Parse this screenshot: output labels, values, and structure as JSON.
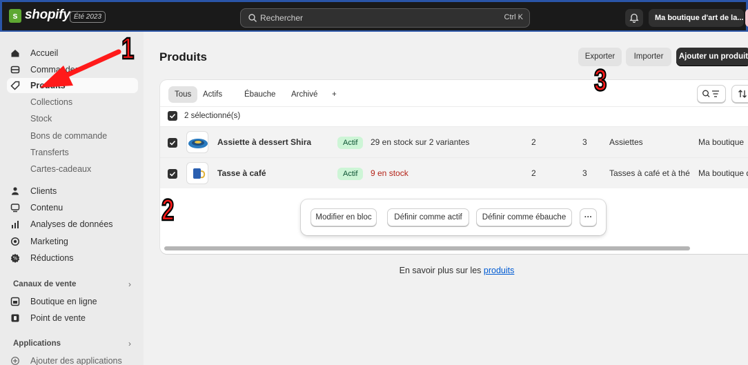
{
  "topbar": {
    "logo_letter": "s",
    "brand": "shopify",
    "edition_badge": "Été 2023",
    "search_placeholder": "Rechercher",
    "search_shortcut": "Ctrl K",
    "store_name": "Ma boutique d'art de la..."
  },
  "sidebar": {
    "items": [
      {
        "label": "Accueil",
        "icon": "home-icon"
      },
      {
        "label": "Commandes",
        "icon": "orders-icon"
      },
      {
        "label": "Produits",
        "icon": "tag-icon"
      }
    ],
    "sub_items": [
      "Collections",
      "Stock",
      "Bons de commande",
      "Transferts",
      "Cartes-cadeaux"
    ],
    "items2": [
      {
        "label": "Clients",
        "icon": "person-icon"
      },
      {
        "label": "Contenu",
        "icon": "content-icon"
      },
      {
        "label": "Analyses de données",
        "icon": "analytics-icon"
      },
      {
        "label": "Marketing",
        "icon": "target-icon"
      },
      {
        "label": "Réductions",
        "icon": "discount-icon"
      }
    ],
    "sales_channels_head": "Canaux de vente",
    "channels": [
      {
        "label": "Boutique en ligne",
        "icon": "store-icon"
      },
      {
        "label": "Point de vente",
        "icon": "pos-icon"
      }
    ],
    "apps_head": "Applications",
    "add_apps": "Ajouter des applications"
  },
  "main": {
    "title": "Produits",
    "export_label": "Exporter",
    "import_label": "Importer",
    "add_product_label": "Ajouter un produit",
    "tabs": [
      "Tous",
      "Actifs",
      "Ébauche",
      "Archivé",
      "+"
    ],
    "selected_label": "2 sélectionné(s)",
    "rows": [
      {
        "name": "Assiette à dessert Shira",
        "status": "Actif",
        "inventory": "29 en stock sur 2 variantes",
        "col_a": "2",
        "col_b": "3",
        "type": "Assiettes",
        "vendor": "Ma boutique"
      },
      {
        "name": "Tasse à café",
        "status": "Actif",
        "inventory": "9 en stock",
        "col_a": "2",
        "col_b": "3",
        "type": "Tasses à café et à thé",
        "vendor": "Ma boutique d"
      }
    ],
    "bulk_actions": [
      "Modifier en bloc",
      "Définir comme actif",
      "Définir comme ébauche",
      "···"
    ],
    "learn_more_prefix": "En savoir plus sur les ",
    "learn_more_link": "produits"
  },
  "annotations": [
    "1",
    "2",
    "3"
  ],
  "colors": {
    "topbar_bg": "#1a1a1a",
    "logo_green": "#5ea832",
    "active_badge_bg": "#cdf5d6",
    "low_stock_red": "#b42318",
    "link_blue": "#005bd3",
    "annotation_red": "#ff1a1a"
  }
}
